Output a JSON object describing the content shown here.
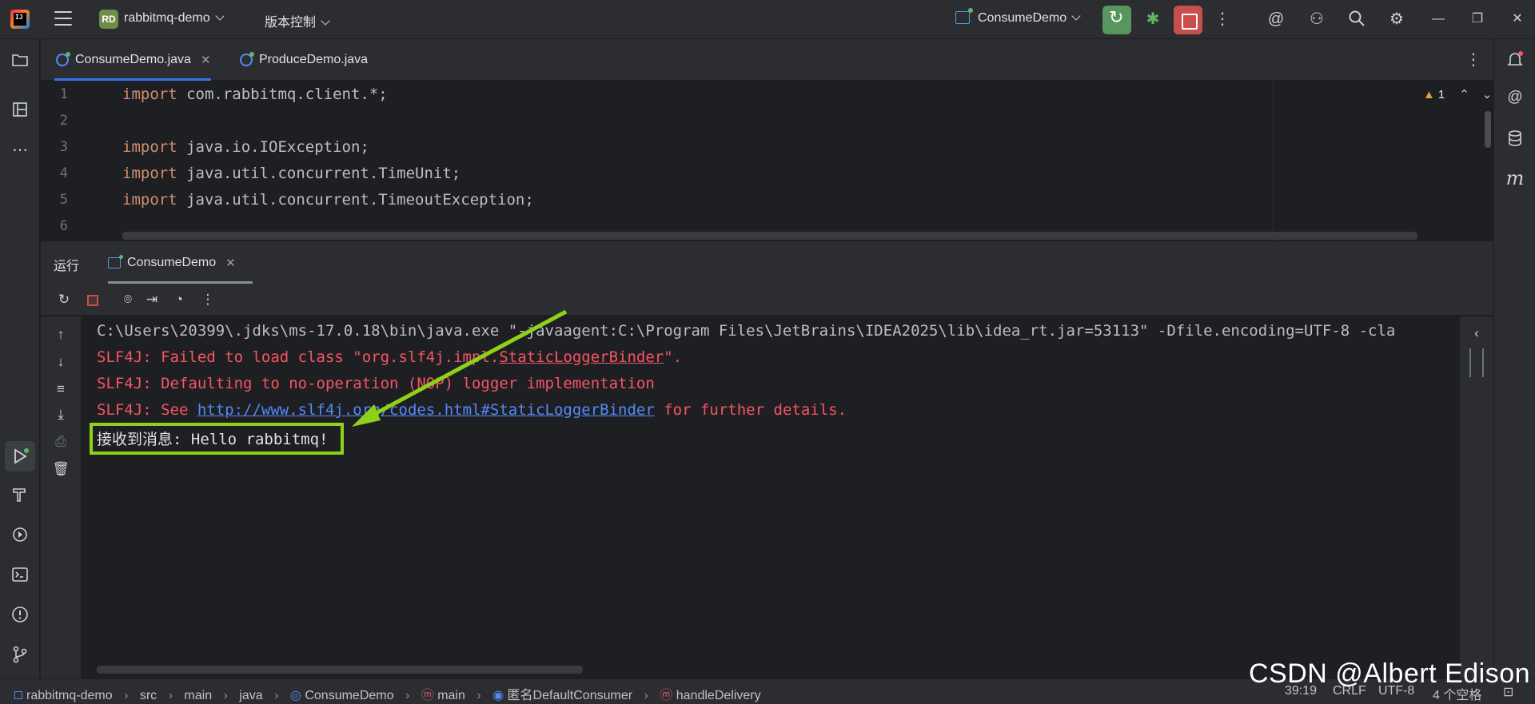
{
  "titlebar": {
    "project_badge": "RD",
    "project_name": "rabbitmq-demo",
    "vcs_menu": "版本控制",
    "run_config": "ConsumeDemo"
  },
  "editor": {
    "tabs": [
      {
        "label": "ConsumeDemo.java",
        "active": true
      },
      {
        "label": "ProduceDemo.java",
        "active": false
      }
    ],
    "warning_count": "1",
    "lines": [
      {
        "num": "1",
        "kw": "import",
        "rest": " com.rabbitmq.client.*;"
      },
      {
        "num": "2",
        "kw": "",
        "rest": ""
      },
      {
        "num": "3",
        "kw": "import",
        "rest": " java.io.IOException;"
      },
      {
        "num": "4",
        "kw": "import",
        "rest": " java.util.concurrent.TimeUnit;"
      },
      {
        "num": "5",
        "kw": "import",
        "rest": " java.util.concurrent.TimeoutException;"
      },
      {
        "num": "6",
        "kw": "",
        "rest": ""
      }
    ]
  },
  "run_panel": {
    "title": "运行",
    "tab_label": "ConsumeDemo"
  },
  "console": {
    "cmd_line": "C:\\Users\\20399\\.jdks\\ms-17.0.18\\bin\\java.exe \"-javaagent:C:\\Program Files\\JetBrains\\IDEA2025\\lib\\idea_rt.jar=53113\" -Dfile.encoding=UTF-8 -cla",
    "err1_prefix": "SLF4J: Failed to load class \"org.slf4j.impl.",
    "err1_link": "StaticLoggerBinder",
    "err1_suffix": "\".",
    "err2": "SLF4J: Defaulting to no-operation (NOP) logger implementation",
    "err3_prefix": "SLF4J: See ",
    "err3_link": "http://www.slf4j.org/codes.html#StaticLoggerBinder",
    "err3_suffix": " for further details.",
    "message": "接收到消息: Hello rabbitmq!"
  },
  "statusbar": {
    "crumbs": [
      "rabbitmq-demo",
      "src",
      "main",
      "java",
      "ConsumeDemo",
      "main",
      "匿名DefaultConsumer",
      "handleDelivery"
    ],
    "position": "39:19",
    "line_sep": "CRLF",
    "encoding": "UTF-8",
    "indent": "4 个空格"
  },
  "watermark": "CSDN @Albert Edison",
  "colors": {
    "highlight_box": "#8ed01a",
    "error_text": "#f75464",
    "link": "#548af7",
    "keyword": "#cf8e6d"
  }
}
